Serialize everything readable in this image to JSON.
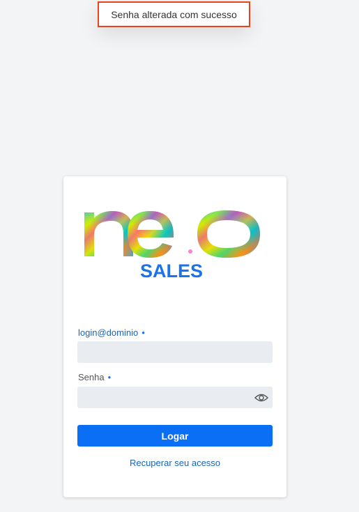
{
  "toast": {
    "message": "Senha alterada com sucesso",
    "border_color": "#e8431f"
  },
  "logo": {
    "wordmark": "neo",
    "subtitle": "SALES",
    "subtitle_color": "#1a73e8"
  },
  "form": {
    "login_label": "login@dominio",
    "login_required_mark": "•",
    "login_value": "",
    "password_label": "Senha",
    "password_required_mark": "•",
    "password_value": "",
    "password_toggle_icon": "eye-icon",
    "submit_label": "Logar",
    "recover_link": "Recuperar seu acesso"
  },
  "colors": {
    "primary": "#0b6ff5",
    "link": "#1565c0",
    "input_bg": "#e9ecf0",
    "page_bg": "#f3f4f6"
  }
}
